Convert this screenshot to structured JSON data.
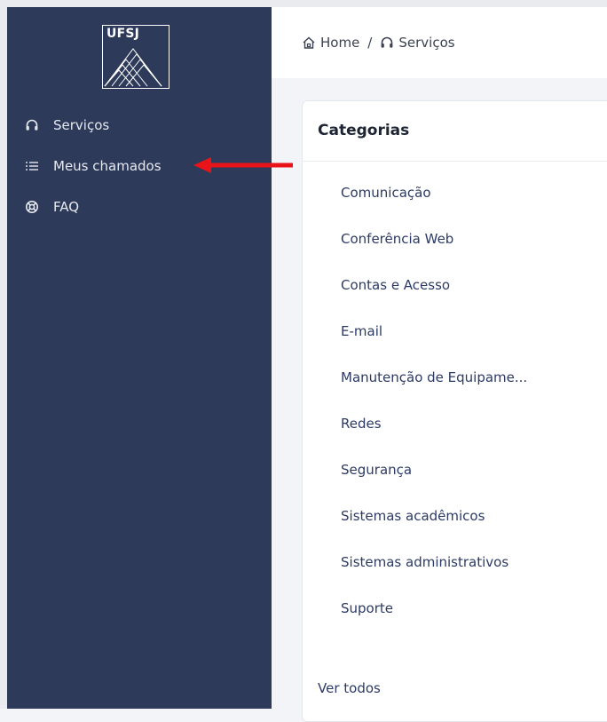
{
  "logo": {
    "text": "UFSJ"
  },
  "sidebar": {
    "items": [
      {
        "label": "Serviços",
        "icon": "headset-icon"
      },
      {
        "label": "Meus chamados",
        "icon": "list-icon"
      },
      {
        "label": "FAQ",
        "icon": "lifebuoy-icon"
      }
    ]
  },
  "breadcrumb": {
    "home": "Home",
    "separator": "/",
    "current": "Serviços"
  },
  "categories": {
    "title": "Categorias",
    "items": [
      "Comunicação",
      "Conferência Web",
      "Contas e Acesso",
      "E-mail",
      "Manutenção de Equipame...",
      "Redes",
      "Segurança",
      "Sistemas acadêmicos",
      "Sistemas administrativos",
      "Suporte"
    ],
    "see_all": "Ver todos"
  },
  "colors": {
    "sidebar": "#2e3a59",
    "annotation_arrow": "#e8141a",
    "link": "#2c3a66"
  }
}
